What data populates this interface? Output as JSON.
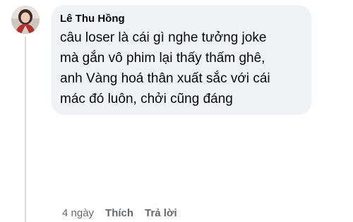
{
  "comment": {
    "author": "Lê Thu Hồng",
    "text": "câu loser là cái gì nghe tưởng joke\nmà gắn vô phim lại thấy thấm ghê,\nanh Vàng hoá thân xuất sắc với cái\nmác đó luôn, chởi cũng đáng",
    "avatar_icon": "user-avatar-photo"
  },
  "actions": {
    "time": "4 ngày",
    "like_label": "Thích",
    "reply_label": "Trả lời"
  },
  "colors": {
    "bubble_bg": "#f0f2f5",
    "secondary_text": "#65676b",
    "primary_text": "#050505",
    "thread_line": "#d6d9dd"
  }
}
